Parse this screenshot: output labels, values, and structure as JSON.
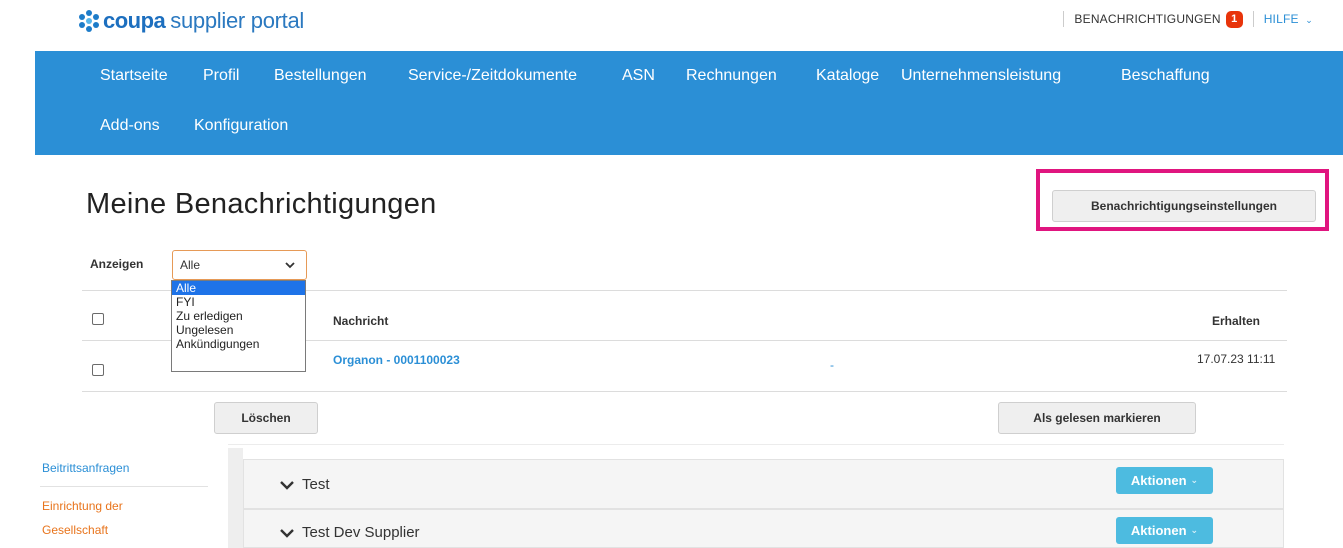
{
  "header": {
    "logo_brand": "coupa",
    "logo_product": "supplier portal",
    "notifications_label": "BENACHRICHTIGUNGEN",
    "notifications_count": "1",
    "help_label": "HILFE",
    "help_chevron": "⌄"
  },
  "nav": {
    "items": [
      "Startseite",
      "Profil",
      "Bestellungen",
      "Service-/Zeitdokumente",
      "ASN",
      "Rechnungen",
      "Kataloge",
      "Unternehmensleistung",
      "Beschaffung",
      "Add-ons",
      "Konfiguration"
    ],
    "color": "#2b8fd6"
  },
  "page": {
    "title": "Meine Benachrichtigungen",
    "settings_button": "Benachrichtigungseinstellungen",
    "highlight_color": "#e0157f"
  },
  "filter": {
    "label": "Anzeigen",
    "selected": "Alle",
    "options": [
      "Alle",
      "FYI",
      "Zu erledigen",
      "Ungelesen",
      "Ankündigungen"
    ]
  },
  "table": {
    "columns": {
      "message": "Nachricht",
      "received": "Erhalten"
    },
    "rows": [
      {
        "message": "Organon - 0001100023",
        "extra": "-",
        "received": "17.07.23 11:11"
      }
    ]
  },
  "actions": {
    "delete_label": "Löschen",
    "mark_read_label": "Als gelesen markieren"
  },
  "lower": {
    "sidebar": {
      "join_requests": "Beitrittsanfragen",
      "company_setup_line1": "Einrichtung der",
      "company_setup_line2": "Gesellschaft"
    },
    "panels": [
      {
        "title": "Test",
        "action_label": "Aktionen"
      },
      {
        "title": "Test Dev Supplier",
        "action_label": "Aktionen"
      }
    ],
    "accent_color": "#4dbbe0"
  },
  "icons": {
    "logo": "coupa-logo-icon",
    "dropdown": "chevron-down-icon",
    "panel": "chevron-down-icon"
  }
}
